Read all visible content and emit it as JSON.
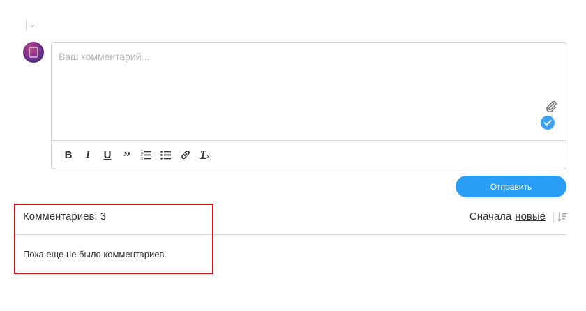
{
  "composer": {
    "placeholder": "Ваш комментарий...",
    "toolbar": [
      {
        "id": "bold",
        "label": "B"
      },
      {
        "id": "italic",
        "label": "I"
      },
      {
        "id": "underline",
        "label": "U"
      },
      {
        "id": "quote",
        "label": "”"
      },
      {
        "id": "ordered-list",
        "icon": "ordered-list-icon"
      },
      {
        "id": "bullet-list",
        "icon": "bullet-list-icon"
      },
      {
        "id": "link",
        "icon": "link-icon"
      },
      {
        "id": "clear-format",
        "label": "T"
      }
    ],
    "send_label": "Отправить",
    "accent_color": "#2a9df4"
  },
  "comments": {
    "count_label": "Комментариев: 3",
    "sort_prefix": "Сначала",
    "sort_value": "новые",
    "empty_text": "Пока еще не было комментариев"
  },
  "highlight_color": "#d9141c"
}
